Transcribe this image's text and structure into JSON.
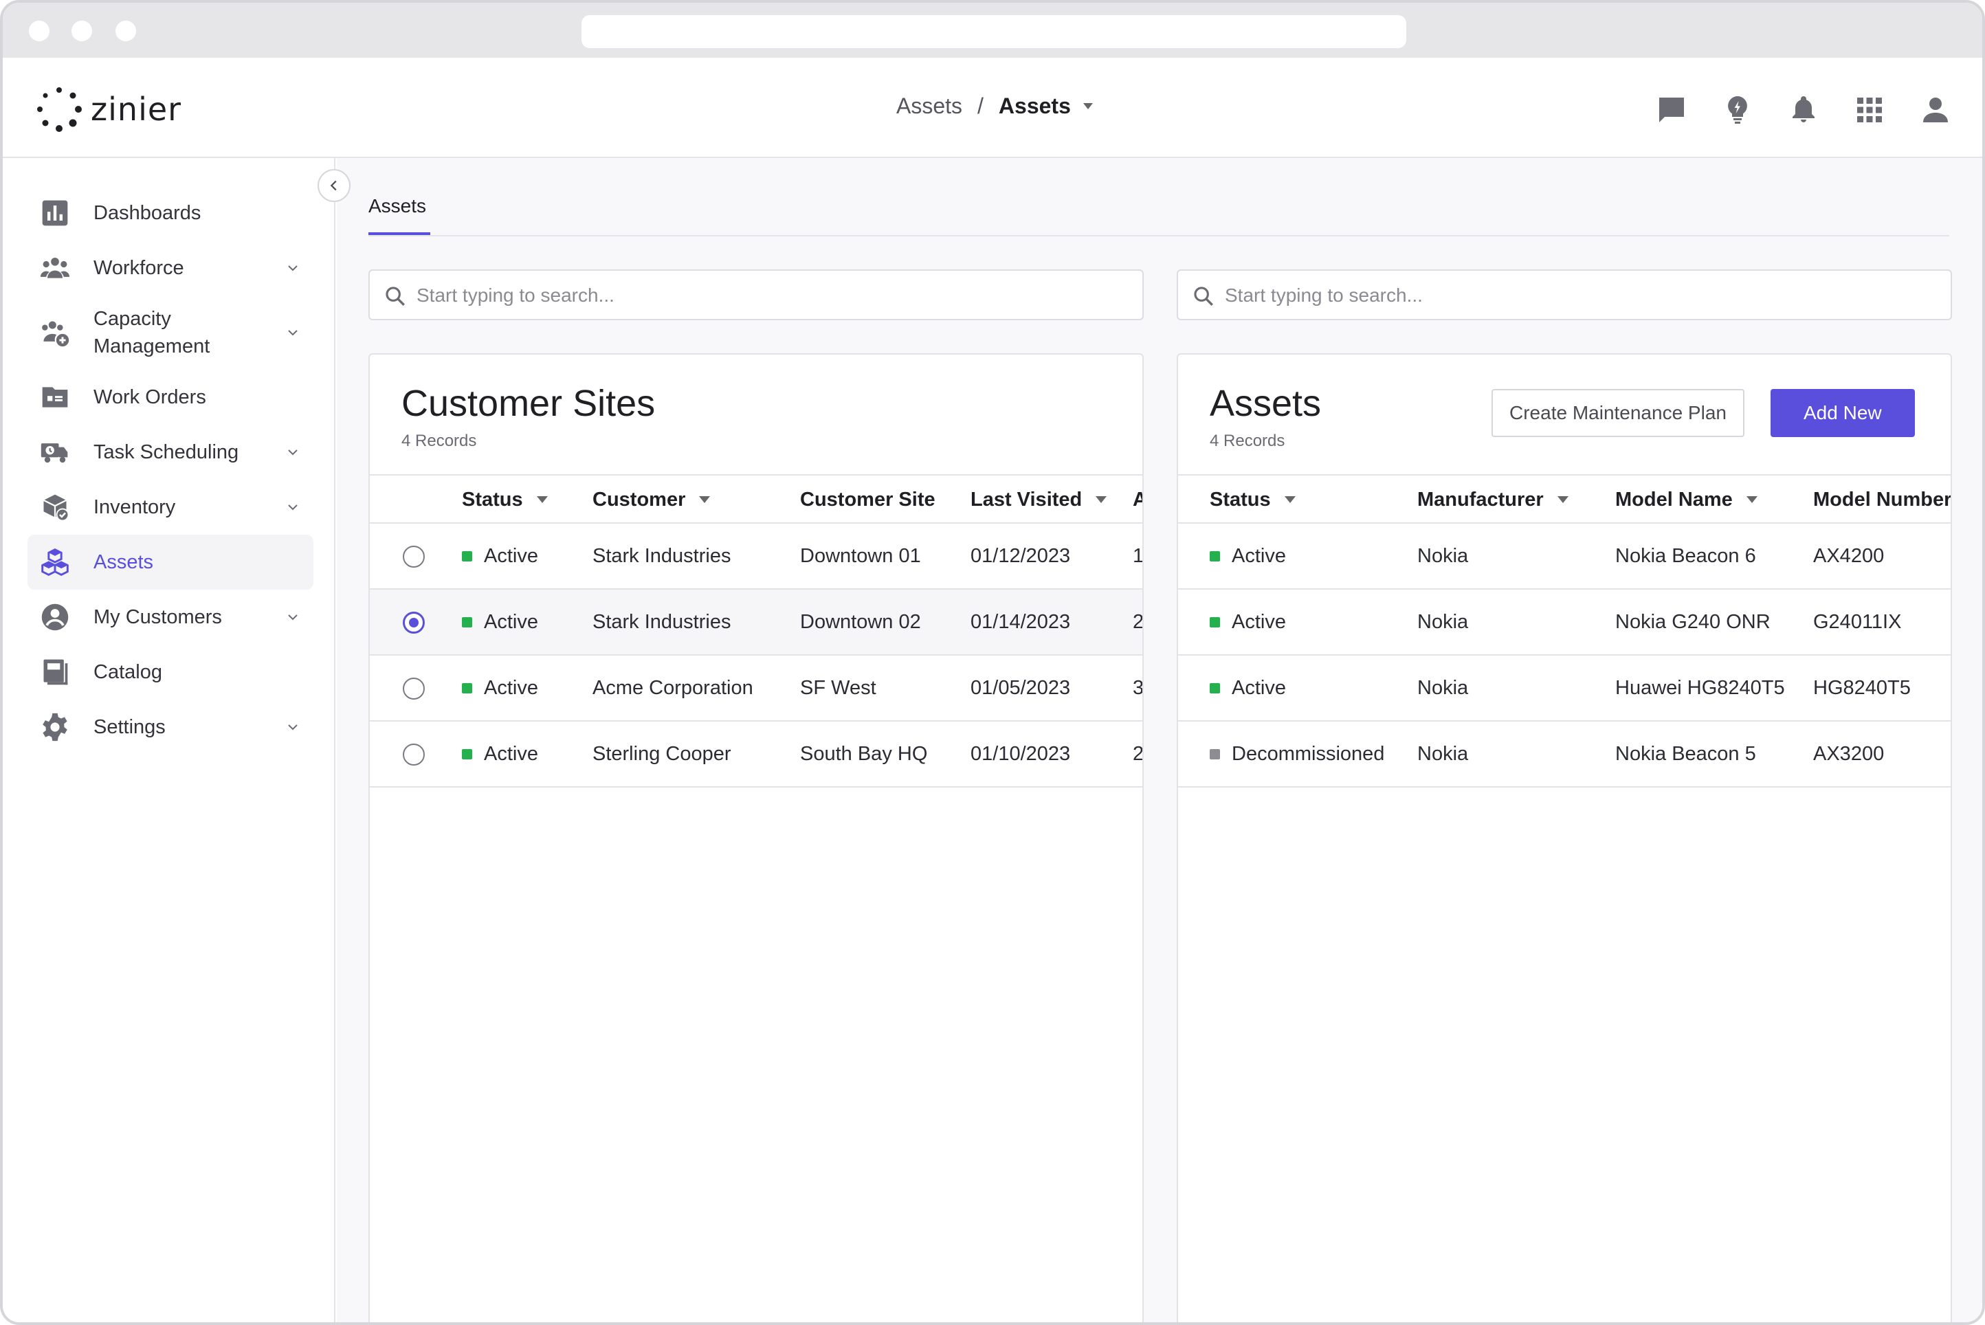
{
  "app": {
    "logo_text": "zinier",
    "breadcrumb": {
      "parent": "Assets",
      "separator": "/",
      "current": "Assets"
    }
  },
  "header_icons": [
    "chat-icon",
    "lightbulb-icon",
    "bell-icon",
    "apps-grid-icon",
    "user-icon"
  ],
  "sidebar": {
    "items": [
      {
        "label": "Dashboards",
        "icon": "dashboard-icon",
        "expandable": false
      },
      {
        "label": "Workforce",
        "icon": "workforce-icon",
        "expandable": true
      },
      {
        "label": "Capacity\nManagement",
        "icon": "capacity-icon",
        "expandable": true
      },
      {
        "label": "Work Orders",
        "icon": "work-orders-icon",
        "expandable": false
      },
      {
        "label": "Task Scheduling",
        "icon": "task-scheduling-icon",
        "expandable": true
      },
      {
        "label": "Inventory",
        "icon": "inventory-icon",
        "expandable": true
      },
      {
        "label": "Assets",
        "icon": "assets-icon",
        "expandable": false,
        "active": true
      },
      {
        "label": "My Customers",
        "icon": "customers-icon",
        "expandable": true
      },
      {
        "label": "Catalog",
        "icon": "catalog-icon",
        "expandable": false
      },
      {
        "label": "Settings",
        "icon": "settings-icon",
        "expandable": true
      }
    ]
  },
  "main": {
    "tab": "Assets",
    "left_search": {
      "placeholder": "Start typing to search..."
    },
    "right_search": {
      "placeholder": "Start typing to search..."
    },
    "customer_sites": {
      "title": "Customer Sites",
      "records": "4 Records",
      "columns": [
        "Status",
        "Customer",
        "Customer Site",
        "Last Visited",
        "A"
      ],
      "rows": [
        {
          "status": "Active",
          "customer": "Stark Industries",
          "site": "Downtown 01",
          "last_visited": "01/12/2023",
          "extra": "1",
          "selected": false
        },
        {
          "status": "Active",
          "customer": "Stark Industries",
          "site": "Downtown 02",
          "last_visited": "01/14/2023",
          "extra": "2",
          "selected": true
        },
        {
          "status": "Active",
          "customer": "Acme Corporation",
          "site": "SF West",
          "last_visited": "01/05/2023",
          "extra": "3",
          "selected": false
        },
        {
          "status": "Active",
          "customer": "Sterling Cooper",
          "site": "South Bay HQ",
          "last_visited": "01/10/2023",
          "extra": "2",
          "selected": false
        }
      ]
    },
    "assets": {
      "title": "Assets",
      "records": "4 Records",
      "create_plan_label": "Create Maintenance Plan",
      "add_new_label": "Add New",
      "columns": [
        "Status",
        "Manufacturer",
        "Model Name",
        "Model Number"
      ],
      "rows": [
        {
          "status": "Active",
          "manufacturer": "Nokia",
          "model_name": "Nokia Beacon 6",
          "model_number": "AX4200"
        },
        {
          "status": "Active",
          "manufacturer": "Nokia",
          "model_name": "Nokia G240 ONR",
          "model_number": "G24011IX"
        },
        {
          "status": "Active",
          "manufacturer": "Nokia",
          "model_name": "Huawei HG8240T5",
          "model_number": "HG8240T5"
        },
        {
          "status": "Decommissioned",
          "manufacturer": "Nokia",
          "model_name": "Nokia Beacon 5",
          "model_number": "AX3200"
        }
      ]
    }
  },
  "colors": {
    "accent": "#5a4fdc",
    "status_active": "#22b14c",
    "status_decommissioned": "#8c8c92"
  }
}
